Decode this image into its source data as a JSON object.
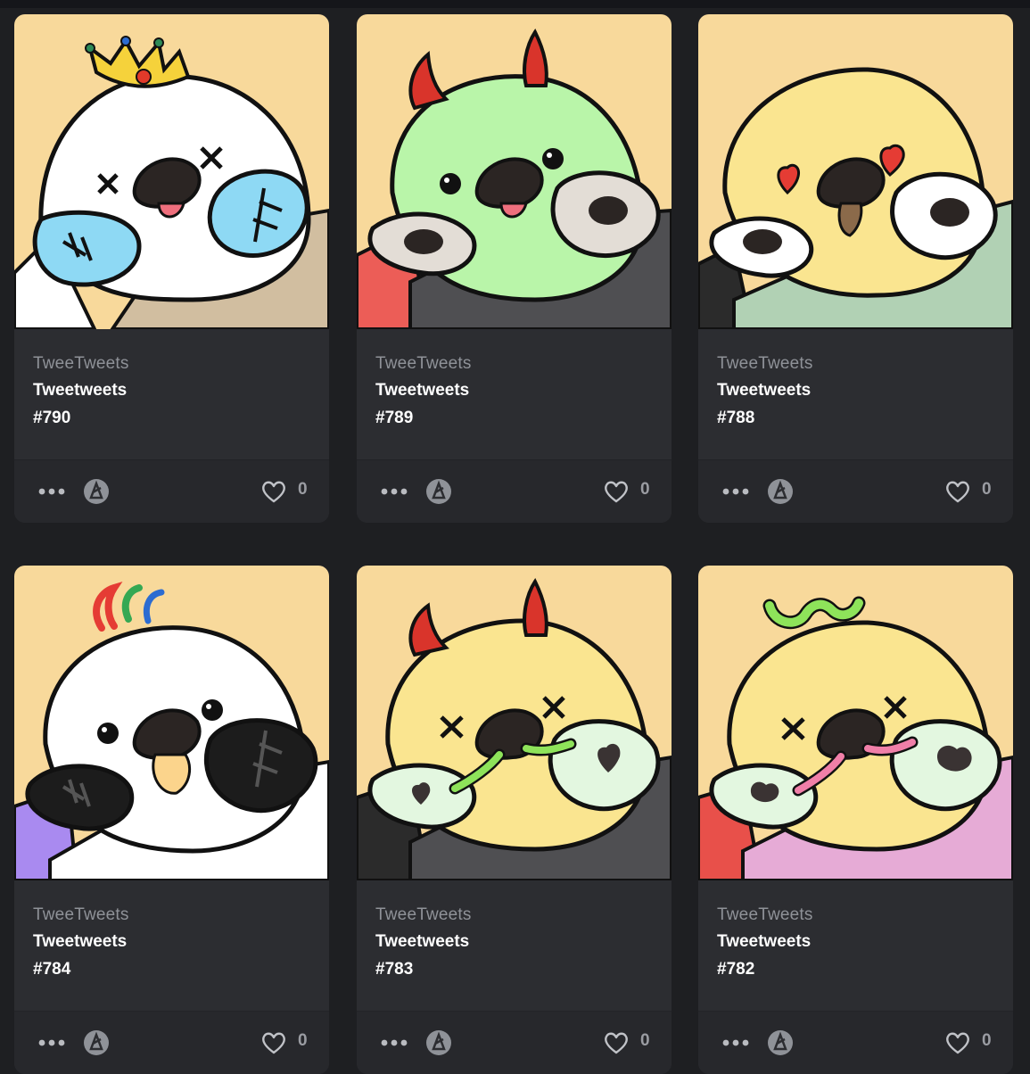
{
  "colors": {
    "page_background": "#1e1f22",
    "card_background": "#2c2d31",
    "card_footer": "#27282c",
    "collection_text": "#8f9298",
    "title_text": "#ffffff",
    "art_background": "#f8d99b"
  },
  "cards": [
    {
      "collection": "TweeTweets",
      "name": "Tweetweets",
      "number": "#790",
      "likes": "0",
      "trait": "crown, x eyes, stitched blue cheeks"
    },
    {
      "collection": "TweeTweets",
      "name": "Tweetweets",
      "number": "#789",
      "likes": "0",
      "trait": "devil horns, green head"
    },
    {
      "collection": "TweeTweets",
      "name": "Tweetweets",
      "number": "#788",
      "likes": "0",
      "trait": "heart eyes, yellow head"
    },
    {
      "collection": "TweeTweets",
      "name": "Tweetweets",
      "number": "#784",
      "likes": "0",
      "trait": "rainbow crest, white head"
    },
    {
      "collection": "TweeTweets",
      "name": "Tweetweets",
      "number": "#783",
      "likes": "0",
      "trait": "devil horns, worm"
    },
    {
      "collection": "TweeTweets",
      "name": "Tweetweets",
      "number": "#782",
      "likes": "0",
      "trait": "worm on head, pink worm"
    }
  ],
  "icons": {
    "more": "more-options-icon",
    "chain": "blockchain-logo-icon",
    "like": "heart-icon"
  }
}
